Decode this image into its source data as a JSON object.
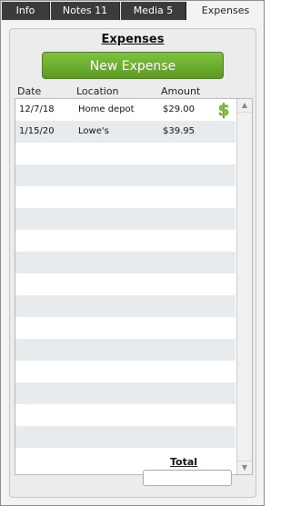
{
  "tabs": [
    {
      "label": "Info"
    },
    {
      "label": "Notes 11"
    },
    {
      "label": "Media 5"
    },
    {
      "label": "Expenses"
    }
  ],
  "active_tab": "Expenses",
  "section_title": "Expenses",
  "new_button_label": "New Expense",
  "columns": {
    "date": "Date",
    "location": "Location",
    "amount": "Amount"
  },
  "expenses": [
    {
      "date": "12/7/18",
      "location": "Home depot",
      "amount": "$29.00",
      "icon": "dollar-icon"
    },
    {
      "date": "1/15/20",
      "location": "Lowe's",
      "amount": "$39.95"
    }
  ],
  "empty_row_count": 15,
  "total_label": "Total",
  "total_value": "",
  "colors": {
    "button_green": "#6aaa2e",
    "dollar_green": "#8cc63f",
    "tab_dark": "#3b3b3b"
  }
}
